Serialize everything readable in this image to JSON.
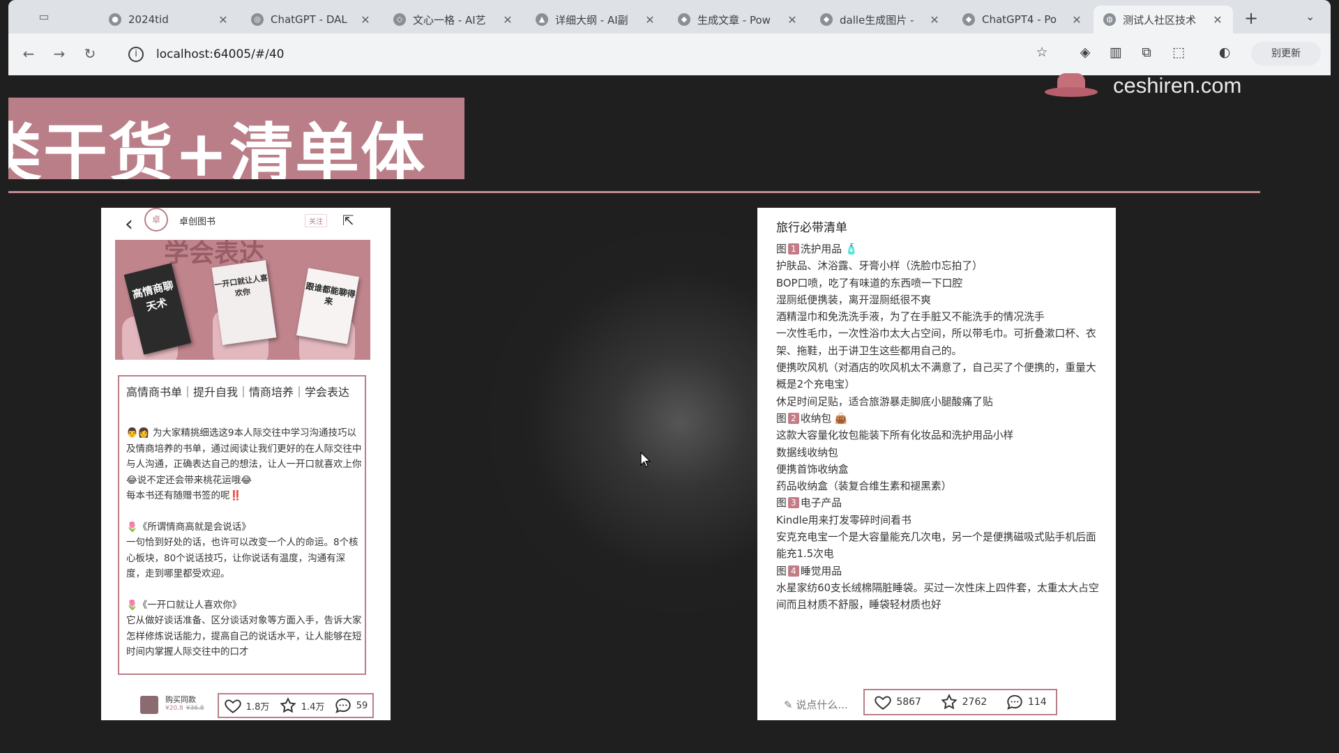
{
  "browser": {
    "tabs": [
      {
        "title": "2024tid",
        "active": false
      },
      {
        "title": "ChatGPT - DAL",
        "active": false
      },
      {
        "title": "文心一格 - AI艺",
        "active": false
      },
      {
        "title": "详细大纲 - AI副",
        "active": false
      },
      {
        "title": "生成文章 - Pow",
        "active": false
      },
      {
        "title": "dalle生成图片 -",
        "active": false
      },
      {
        "title": "ChatGPT4 - Po",
        "active": false
      },
      {
        "title": "测试人社区技术",
        "active": true
      }
    ],
    "url": "localhost:64005/#/40",
    "profile_label": "别更新"
  },
  "slide": {
    "brand_text": "ceshiren.com",
    "headline": "类干货+清单体"
  },
  "left_post": {
    "author": "卓创图书",
    "follow_label": "关注",
    "image_banner": "学会表达",
    "book1": "高情商聊天术",
    "book2": "一开口就让人喜欢你",
    "book3": "跟谁都能聊得来",
    "title": "高情商书单｜提升自我｜情商培养｜学会表达",
    "body": [
      "👨‍👩 为大家精挑细选这9本人际交往中学习沟通技巧以及情商培养的书单，通过阅读让我们更好的在人际交往中与人沟通，正确表达自己的想法，让人一开口就喜欢上你😂说不定还会带来桃花运哦😂",
      "每本书还有随赠书签的呢‼️",
      "",
      "🌷《所谓情商高就是会说话》",
      "一句恰到好处的话，也许可以改变一个人的命运。8个核心板块，80个说话技巧，让你说话有温度，沟通有深度，走到哪里都受欢迎。",
      "",
      "🌷《一开口就让人喜欢你》",
      "它从做好谈话准备、区分谈话对象等方面入手，告诉大家怎样修炼说话能力，提高自己的说话水平，让人能够在短时间内掌握人际交往中的口才"
    ],
    "shop_label": "购买同款",
    "price": "¥20.8",
    "old_price": "¥36.8",
    "likes": "1.8万",
    "collects": "1.4万",
    "comments": "59"
  },
  "right_post": {
    "title": "旅行必带清单",
    "lines": [
      {
        "pre": "图",
        "num": "1",
        "text": "洗护用品 🧴"
      },
      {
        "text": "护肤品、沐浴露、牙膏小样（洗脸巾忘拍了）"
      },
      {
        "text": "BOP口喷，吃了有味道的东西喷一下口腔"
      },
      {
        "text": "湿厕纸便携装，离开湿厕纸很不爽"
      },
      {
        "text": "酒精湿巾和免洗洗手液，为了在手脏又不能洗手的情况洗手"
      },
      {
        "text": "一次性毛巾，一次性浴巾太大占空间，所以带毛巾。可折叠漱口杯、衣架、拖鞋，出于讲卫生这些都用自己的。"
      },
      {
        "text": "便携吹风机（对酒店的吹风机太不满意了，自己买了个便携的，重量大概是2个充电宝）"
      },
      {
        "text": "休足时间足贴，适合旅游暴走脚底小腿酸痛了贴"
      },
      {
        "pre": "图",
        "num": "2",
        "text": "收纳包 👜"
      },
      {
        "text": "这款大容量化妆包能装下所有化妆品和洗护用品小样"
      },
      {
        "text": "数据线收纳包"
      },
      {
        "text": "便携首饰收纳盒"
      },
      {
        "text": "药品收纳盒（装复合维生素和褪黑素）"
      },
      {
        "pre": "图",
        "num": "3",
        "text": "电子产品"
      },
      {
        "text": "Kindle用来打发零碎时间看书"
      },
      {
        "text": "安克充电宝一个是大容量能充几次电，另一个是便携磁吸式贴手机后面能充1.5次电"
      },
      {
        "pre": "图",
        "num": "4",
        "text": "睡觉用品"
      },
      {
        "text": "水星家纺60支长绒棉隔脏睡袋。买过一次性床上四件套，太重太大占空间而且材质不舒服，睡袋轻材质也好"
      }
    ],
    "comment_placeholder": "说点什么...",
    "likes": "5867",
    "collects": "2762",
    "comments": "114"
  },
  "colors": {
    "accent": "#b97e87",
    "background": "#1f1f1f",
    "chrome": "#f1f3f4"
  }
}
